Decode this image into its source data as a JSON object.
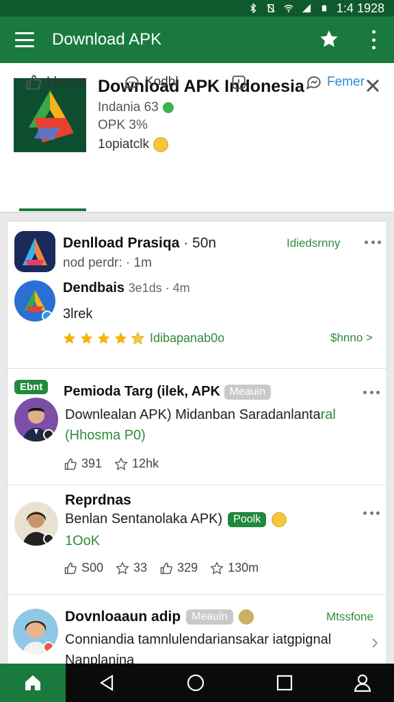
{
  "status_bar": {
    "time": "1:4 1928"
  },
  "app_bar": {
    "title": "Download APK"
  },
  "app_card": {
    "title": "Download APK Indonesia",
    "meta1": "Indania 63",
    "meta2": "OPK 3%",
    "meta3": "1opiatclk",
    "tabs": [
      {
        "label": "Lbeme"
      },
      {
        "label": "Kodbl"
      },
      {
        "label": ""
      },
      {
        "label": "Femer"
      }
    ]
  },
  "posts": [
    {
      "name": "Denlload Prasiqa",
      "name_suffix": "· 50n",
      "tag": "Idiedsrnny",
      "sub": "nod perdr: · 1m",
      "name2": "Dendbais",
      "sub2": "3e1ds · 4m",
      "body": "3lrek",
      "rating_label": "Idibapanab0o",
      "share": "$hnno >"
    },
    {
      "label": "Ebnt",
      "name": "Pemioda Targ (ilek, APK",
      "badge": "Meauin",
      "body1": "Downlealan APK) Midanban Saradanlanta",
      "body1_suffix": "ral",
      "body2": "(Hhosma P0)",
      "likes": "391",
      "stars": "12hk"
    },
    {
      "name": "Reprdnas",
      "body1": "Benlan Sentanolaka APK)",
      "badge": "Poolk",
      "body2": "1OoK",
      "a1": "S00",
      "a2": "33",
      "a3": "329",
      "a4": "130m"
    },
    {
      "name": "Dovnloaaun adip",
      "badge": "Meauin",
      "tag": "Mtssfone",
      "body1": "Conniandia tamnlulendariansakar iatgpignal",
      "body2": "Nanplanina"
    }
  ],
  "colors": {
    "primary": "#1a7a3e",
    "status": "#0f5a2c",
    "accent": "#2e8b3a"
  }
}
